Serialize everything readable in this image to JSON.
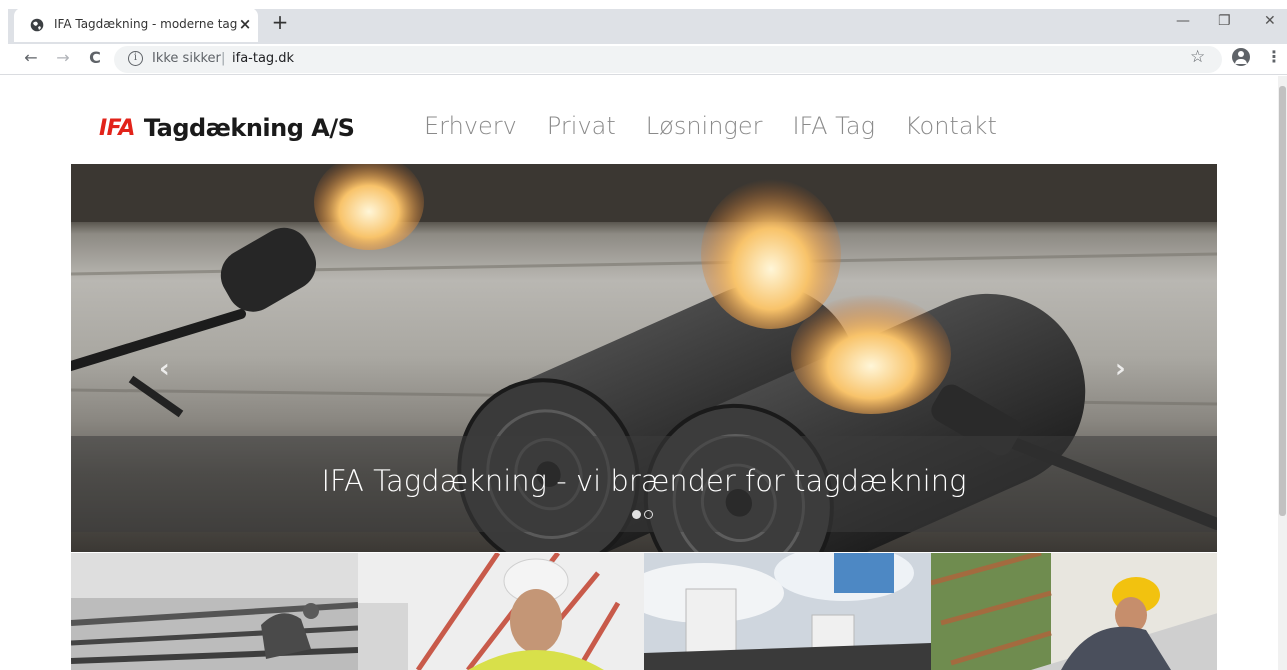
{
  "browser": {
    "tab": {
      "title": "IFA Tagdækning - moderne tag",
      "close": "×"
    },
    "new_tab": "+",
    "window_controls": {
      "minimize": "—",
      "restore": "❐",
      "close": "✕"
    },
    "nav": {
      "back": "←",
      "forward": "→",
      "reload": "C"
    },
    "omnibox": {
      "info_icon": "i",
      "security_label": "Ikke sikker",
      "separator": "|",
      "url": "ifa-tag.dk"
    },
    "star": "☆",
    "menu": "⋮"
  },
  "header": {
    "logo_mark": "IFA",
    "logo_text": "Tagdækning A/S",
    "nav_items": [
      "Erhverv",
      "Privat",
      "Løsninger",
      "IFA Tag",
      "Kontakt"
    ]
  },
  "hero": {
    "caption": "IFA Tagdækning - vi brænder for tagdækning",
    "prev_arrow": "‹",
    "next_arrow": "›",
    "slide_count": 2,
    "active_slide": 1
  },
  "colors": {
    "brand_red": "#e2231a",
    "nav_text": "#8a8a8a",
    "chrome_bg": "#dee1e6"
  }
}
